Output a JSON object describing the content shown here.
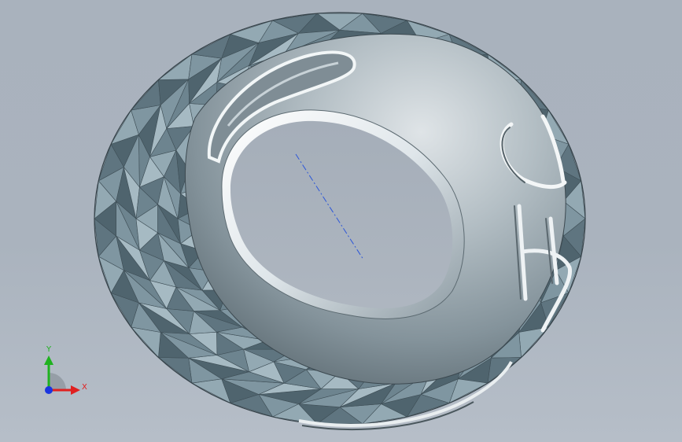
{
  "viewport": {
    "background_top": "#a9b2bd",
    "background_bottom": "#b6bec8"
  },
  "model": {
    "facet_colors": [
      "#5f7580",
      "#6d848f",
      "#7f96a1",
      "#93a9b3",
      "#a6bac3",
      "#4f646e"
    ],
    "shell_colors": [
      "#e3e7ea",
      "#aeb9bf",
      "#7c8a92",
      "#4d5b62"
    ],
    "highlight_color": "#f4f7f8"
  },
  "triad": {
    "x_label": "X",
    "y_label": "Y",
    "x_color": "#e02020",
    "y_color": "#1fb21f",
    "z_color": "#1a35e0"
  }
}
